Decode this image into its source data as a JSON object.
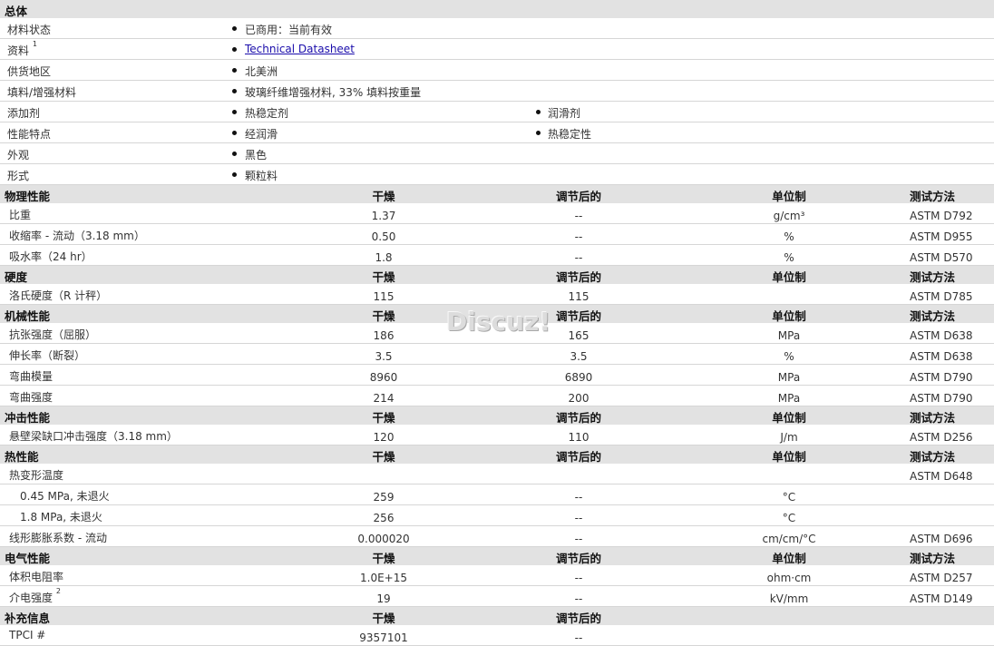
{
  "general": {
    "title": "总体",
    "rows": [
      {
        "label": "材料状态",
        "values": [
          "已商用：当前有效"
        ]
      },
      {
        "label": "资料",
        "sup": "1",
        "values": [
          "Technical Datasheet"
        ],
        "link": true
      },
      {
        "label": "供货地区",
        "values": [
          "北美洲"
        ]
      },
      {
        "label": "填料/增强材料",
        "values": [
          "玻璃纤维增强材料, 33% 填料按重量"
        ]
      },
      {
        "label": "添加剂",
        "values": [
          "热稳定剂",
          "润滑剂"
        ]
      },
      {
        "label": "性能特点",
        "values": [
          "经润滑",
          "热稳定性"
        ]
      },
      {
        "label": "外观",
        "values": [
          "黑色"
        ]
      },
      {
        "label": "形式",
        "values": [
          "颗粒料"
        ]
      }
    ]
  },
  "columns": {
    "dry": "干燥",
    "conditioned": "调节后的",
    "unit": "单位制",
    "method": "测试方法"
  },
  "sections": [
    {
      "title": "物理性能",
      "rows": [
        {
          "label": "比重",
          "dry": "1.37",
          "cond": "--",
          "unit": "g/cm³",
          "method": "ASTM D792"
        },
        {
          "label": "收缩率 - 流动（3.18 mm）",
          "dry": "0.50",
          "cond": "--",
          "unit": "%",
          "method": "ASTM D955"
        },
        {
          "label": "吸水率（24 hr）",
          "dry": "1.8",
          "cond": "--",
          "unit": "%",
          "method": "ASTM D570"
        }
      ]
    },
    {
      "title": "硬度",
      "rows": [
        {
          "label": "洛氏硬度（R 计秤）",
          "dry": "115",
          "cond": "115",
          "unit": "",
          "method": "ASTM D785"
        }
      ]
    },
    {
      "title": "机械性能",
      "rows": [
        {
          "label": "抗张强度（屈服）",
          "dry": "186",
          "cond": "165",
          "unit": "MPa",
          "method": "ASTM D638"
        },
        {
          "label": "伸长率（断裂）",
          "dry": "3.5",
          "cond": "3.5",
          "unit": "%",
          "method": "ASTM D638"
        },
        {
          "label": "弯曲模量",
          "dry": "8960",
          "cond": "6890",
          "unit": "MPa",
          "method": "ASTM D790"
        },
        {
          "label": "弯曲强度",
          "dry": "214",
          "cond": "200",
          "unit": "MPa",
          "method": "ASTM D790"
        }
      ]
    },
    {
      "title": "冲击性能",
      "rows": [
        {
          "label": "悬壁梁缺口冲击强度（3.18 mm）",
          "dry": "120",
          "cond": "110",
          "unit": "J/m",
          "method": "ASTM D256"
        }
      ]
    },
    {
      "title": "热性能",
      "rows": [
        {
          "label": "热变形温度",
          "dry": "",
          "cond": "",
          "unit": "",
          "method": "ASTM D648"
        },
        {
          "label": "0.45 MPa, 未退火",
          "indent": true,
          "dry": "259",
          "cond": "--",
          "unit": "°C",
          "method": ""
        },
        {
          "label": "1.8 MPa, 未退火",
          "indent": true,
          "dry": "256",
          "cond": "--",
          "unit": "°C",
          "method": ""
        },
        {
          "label": "线形膨胀系数 - 流动",
          "dry": "0.000020",
          "cond": "--",
          "unit": "cm/cm/°C",
          "method": "ASTM D696"
        }
      ]
    },
    {
      "title": "电气性能",
      "rows": [
        {
          "label": "体积电阻率",
          "dry": "1.0E+15",
          "cond": "--",
          "unit": "ohm·cm",
          "method": "ASTM D257"
        },
        {
          "label": "介电强度",
          "sup": "2",
          "dry": "19",
          "cond": "--",
          "unit": "kV/mm",
          "method": "ASTM D149"
        }
      ]
    },
    {
      "title": "补充信息",
      "noUnitCols": true,
      "rows": [
        {
          "label": "TPCI #",
          "dry": "9357101",
          "cond": "--",
          "unit": "",
          "method": ""
        }
      ]
    }
  ],
  "watermark": "Discuz!"
}
